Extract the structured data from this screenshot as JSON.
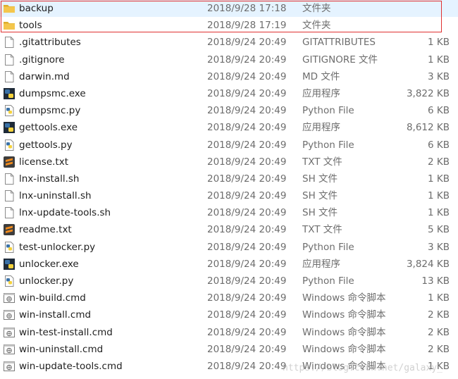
{
  "files": [
    {
      "name": "backup",
      "date": "2018/9/28 17:18",
      "type": "文件夹",
      "size": "",
      "icon": "folder-icon"
    },
    {
      "name": "tools",
      "date": "2018/9/28 17:19",
      "type": "文件夹",
      "size": "",
      "icon": "folder-icon"
    },
    {
      "name": ".gitattributes",
      "date": "2018/9/24 20:49",
      "type": "GITATTRIBUTES",
      "size": "1 KB",
      "icon": "blank-file-icon"
    },
    {
      "name": ".gitignore",
      "date": "2018/9/24 20:49",
      "type": "GITIGNORE 文件",
      "size": "1 KB",
      "icon": "blank-file-icon"
    },
    {
      "name": "darwin.md",
      "date": "2018/9/24 20:49",
      "type": "MD 文件",
      "size": "3 KB",
      "icon": "blank-file-icon"
    },
    {
      "name": "dumpsmc.exe",
      "date": "2018/9/24 20:49",
      "type": "应用程序",
      "size": "3,822 KB",
      "icon": "python-exe-icon"
    },
    {
      "name": "dumpsmc.py",
      "date": "2018/9/24 20:49",
      "type": "Python File",
      "size": "6 KB",
      "icon": "python-file-icon"
    },
    {
      "name": "gettools.exe",
      "date": "2018/9/24 20:49",
      "type": "应用程序",
      "size": "8,612 KB",
      "icon": "python-exe-icon"
    },
    {
      "name": "gettools.py",
      "date": "2018/9/24 20:49",
      "type": "Python File",
      "size": "6 KB",
      "icon": "python-file-icon"
    },
    {
      "name": "license.txt",
      "date": "2018/9/24 20:49",
      "type": "TXT 文件",
      "size": "2 KB",
      "icon": "sublime-text-icon"
    },
    {
      "name": "lnx-install.sh",
      "date": "2018/9/24 20:49",
      "type": "SH 文件",
      "size": "1 KB",
      "icon": "blank-file-icon"
    },
    {
      "name": "lnx-uninstall.sh",
      "date": "2018/9/24 20:49",
      "type": "SH 文件",
      "size": "1 KB",
      "icon": "blank-file-icon"
    },
    {
      "name": "lnx-update-tools.sh",
      "date": "2018/9/24 20:49",
      "type": "SH 文件",
      "size": "1 KB",
      "icon": "blank-file-icon"
    },
    {
      "name": "readme.txt",
      "date": "2018/9/24 20:49",
      "type": "TXT 文件",
      "size": "5 KB",
      "icon": "sublime-text-icon"
    },
    {
      "name": "test-unlocker.py",
      "date": "2018/9/24 20:49",
      "type": "Python File",
      "size": "3 KB",
      "icon": "python-file-icon"
    },
    {
      "name": "unlocker.exe",
      "date": "2018/9/24 20:49",
      "type": "应用程序",
      "size": "3,824 KB",
      "icon": "python-exe-icon"
    },
    {
      "name": "unlocker.py",
      "date": "2018/9/24 20:49",
      "type": "Python File",
      "size": "13 KB",
      "icon": "python-file-icon"
    },
    {
      "name": "win-build.cmd",
      "date": "2018/9/24 20:49",
      "type": "Windows 命令脚本",
      "size": "1 KB",
      "icon": "cmd-script-icon"
    },
    {
      "name": "win-install.cmd",
      "date": "2018/9/24 20:49",
      "type": "Windows 命令脚本",
      "size": "2 KB",
      "icon": "cmd-script-icon"
    },
    {
      "name": "win-test-install.cmd",
      "date": "2018/9/24 20:49",
      "type": "Windows 命令脚本",
      "size": "2 KB",
      "icon": "cmd-script-icon"
    },
    {
      "name": "win-uninstall.cmd",
      "date": "2018/9/24 20:49",
      "type": "Windows 命令脚本",
      "size": "2 KB",
      "icon": "cmd-script-icon"
    },
    {
      "name": "win-update-tools.cmd",
      "date": "2018/9/24 20:49",
      "type": "Windows 命令脚本",
      "size": "1 KB",
      "icon": "cmd-script-icon"
    }
  ],
  "watermark": "https://blog.csdn.net/galaxy_",
  "colors": {
    "highlight_border": "#e03030",
    "folder": "#f4c64c",
    "python_blue": "#3a72a8",
    "python_yellow": "#f5d23c",
    "sublime": "#f08a1c"
  }
}
